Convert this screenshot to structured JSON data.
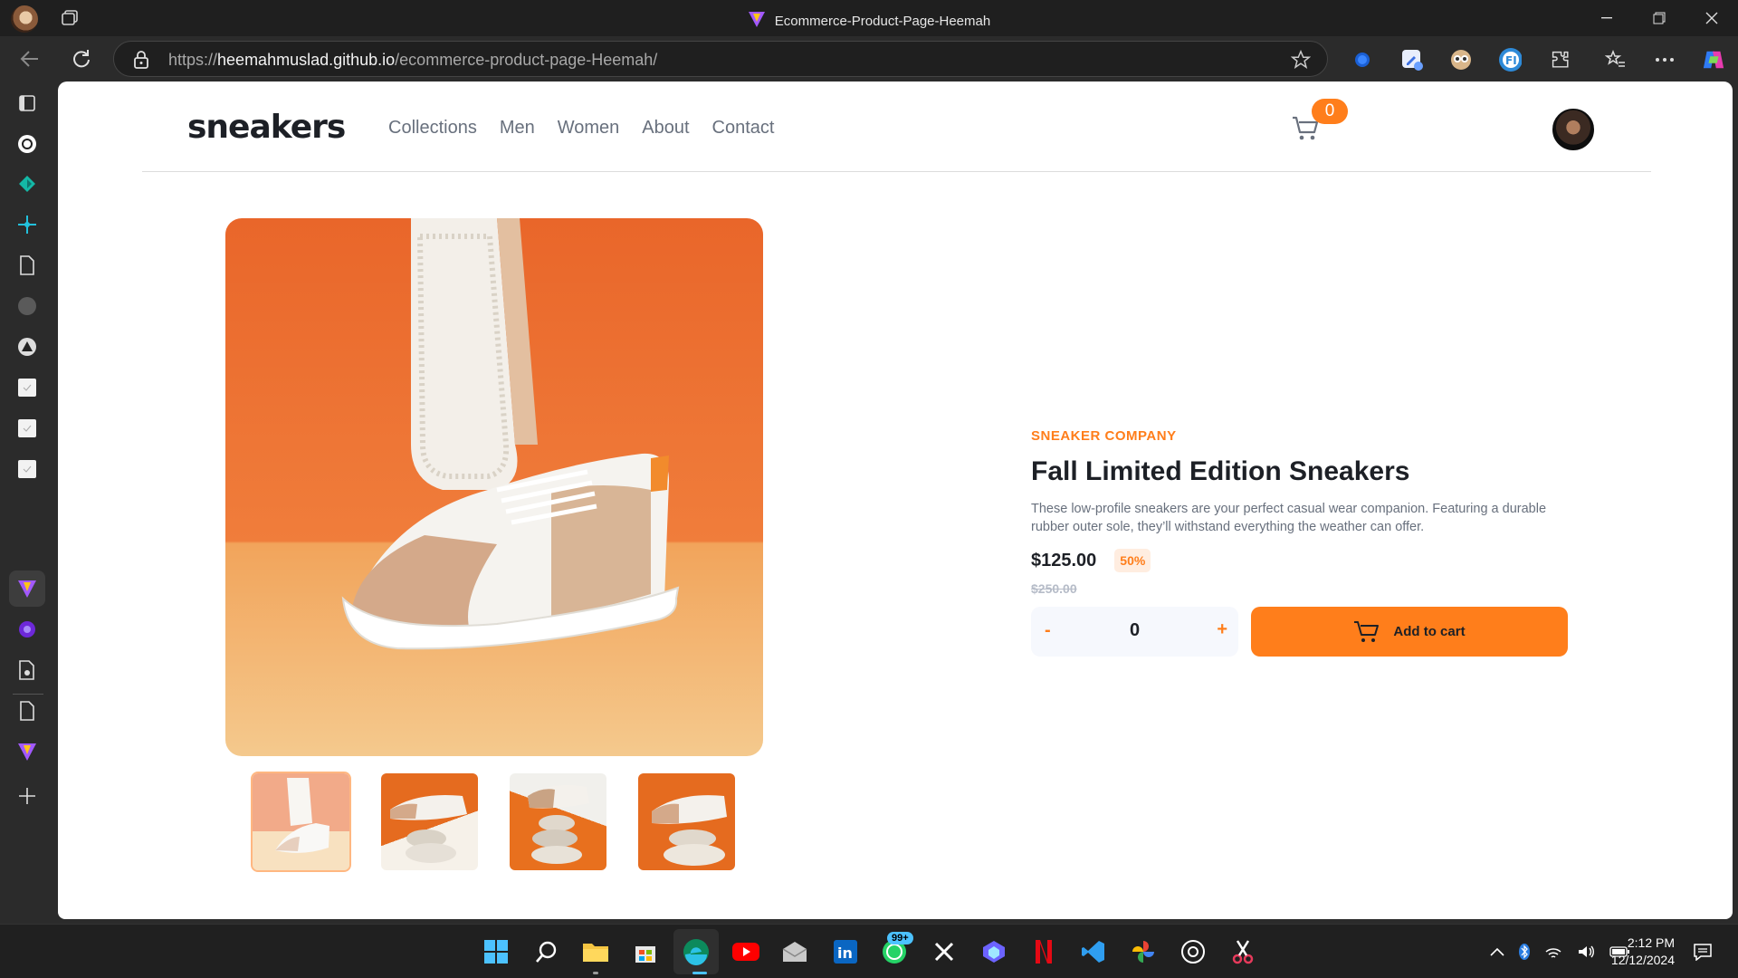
{
  "browser": {
    "tab_title": "Ecommerce-Product-Page-Heemah",
    "url_scheme": "https://",
    "url_host": "heemahmuslad.github.io",
    "url_path": "/ecommerce-product-page-Heemah/"
  },
  "site": {
    "logo": "sneakers",
    "nav": [
      "Collections",
      "Men",
      "Women",
      "About",
      "Contact"
    ],
    "cart_count": "0"
  },
  "product": {
    "company": "SNEAKER COMPANY",
    "name": "Fall Limited Edition Sneakers",
    "description": "These low-profile sneakers are your perfect casual wear companion. Featuring a durable rubber outer sole, they’ll withstand everything the weather can offer.",
    "price": "$125.00",
    "discount": "50%",
    "original_price": "$250.00",
    "quantity": "0",
    "minus_label": "-",
    "plus_label": "+",
    "add_to_cart_label": "Add to cart",
    "thumbnails": 4,
    "active_thumbnail": 1
  },
  "taskbar": {
    "whatsapp_badge": "99+",
    "time": "2:12 PM",
    "date": "12/12/2024"
  },
  "colors": {
    "accent": "#ff7e1b",
    "text_dark": "#1d2026",
    "text_grey": "#68707d"
  }
}
